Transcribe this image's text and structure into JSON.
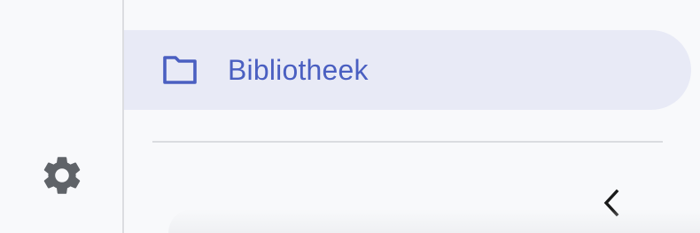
{
  "sidebar": {
    "settings": {
      "icon": "gear-icon",
      "color": "#5f6368"
    },
    "nav_items": [
      {
        "label": "Bibliotheek",
        "icon": "folder-icon",
        "selected": true,
        "color": "#4a5fc1",
        "highlight": "#e8eaf6"
      }
    ],
    "collapse": {
      "icon": "chevron-left-icon",
      "color": "#1a1a1a"
    }
  }
}
